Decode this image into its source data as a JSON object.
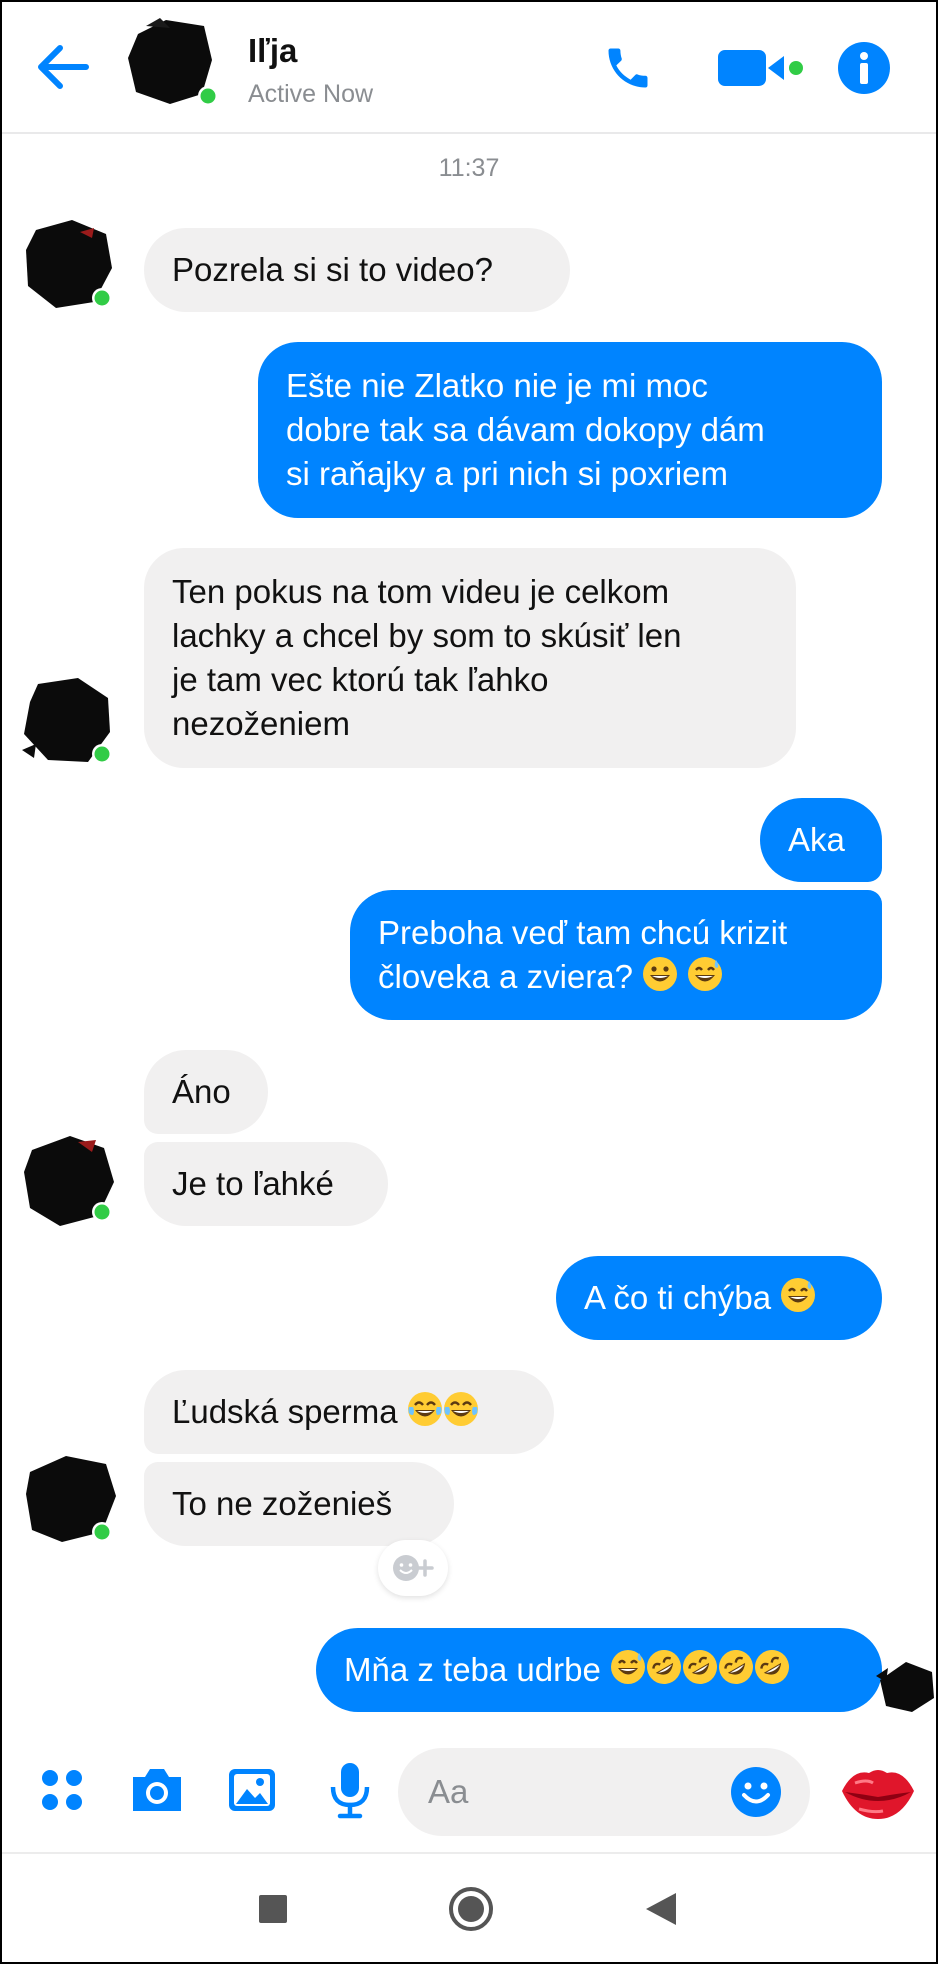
{
  "header": {
    "contact_name": "Iľja",
    "status": "Active Now"
  },
  "conversation": {
    "timestamp": "11:37",
    "messages": [
      {
        "from": "in",
        "text": "Pozrela si si to video?"
      },
      {
        "from": "out",
        "lines": [
          "Ešte nie Zlatko nie je mi moc",
          "dobre tak sa dávam dokopy dám",
          "si raňajky a pri nich si poxriem"
        ]
      },
      {
        "from": "in",
        "lines": [
          "Ten pokus na tom videu je celkom",
          "lachky a chcel by som to skúsiť len",
          "je tam vec ktorú tak ľahko",
          "nezoženiem"
        ]
      },
      {
        "from": "out",
        "text": "Aka"
      },
      {
        "from": "out",
        "lines": [
          "Preboha veď tam chcú krizit",
          "človeka a zviera?"
        ]
      },
      {
        "from": "in",
        "text": "Áno"
      },
      {
        "from": "in",
        "text": "Je to ľahké"
      },
      {
        "from": "out",
        "text": "A čo ti chýba"
      },
      {
        "from": "in",
        "text": "Ľudská sperma"
      },
      {
        "from": "in",
        "text": "To ne zoženieš"
      },
      {
        "from": "out",
        "text": "Mňa z teba udrbe"
      }
    ]
  },
  "composer": {
    "placeholder": "Aa"
  },
  "icons": {
    "back": "back-arrow-icon",
    "call": "phone-icon",
    "video": "video-camera-icon",
    "info": "info-icon",
    "apps": "four-dots-icon",
    "camera": "camera-icon",
    "gallery": "image-icon",
    "mic": "microphone-icon",
    "emoji": "smiley-icon",
    "send_reaction": "lips-icon"
  },
  "colors": {
    "accent": "#0084ff",
    "incoming_bubble": "#f1f0f0",
    "online": "#31cc46"
  }
}
